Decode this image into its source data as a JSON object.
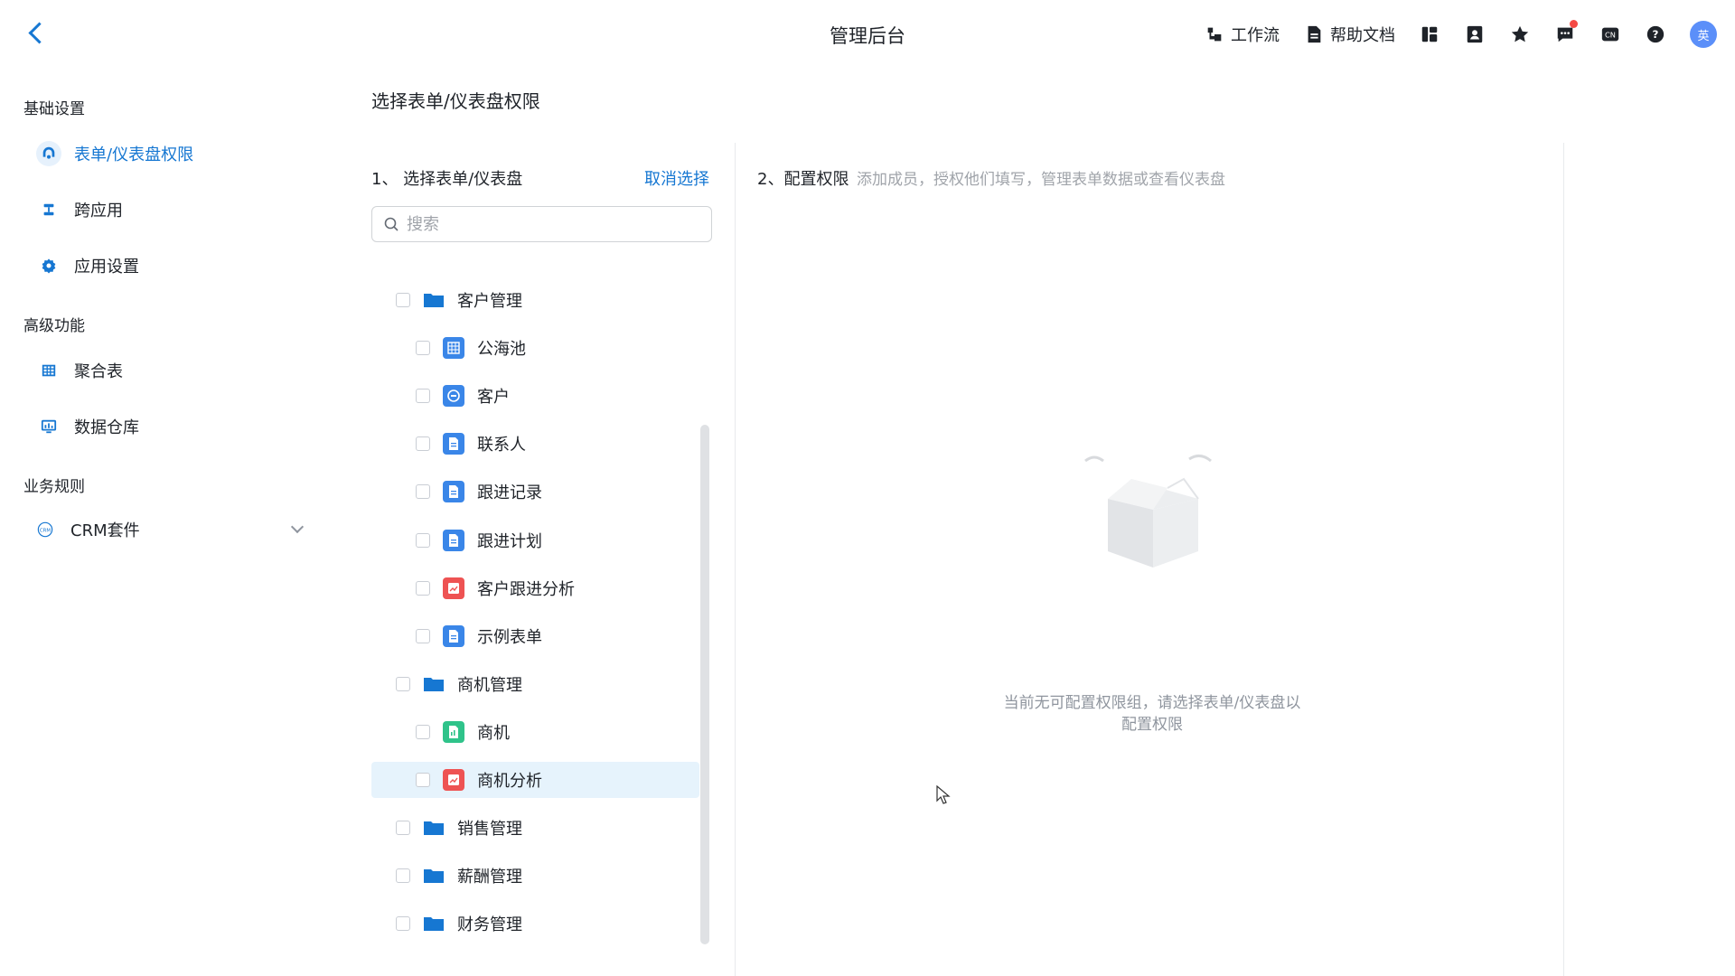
{
  "header": {
    "title": "管理后台",
    "workflow_label": "工作流",
    "help_label": "帮助文档",
    "lang_label": "CN",
    "avatar_text": "英",
    "icons": [
      "workflow-icon",
      "document-icon",
      "layout-icon",
      "contacts-icon",
      "star-icon",
      "message-icon",
      "language-icon",
      "help-icon"
    ]
  },
  "sidebar": {
    "groups": [
      {
        "label": "基础设置"
      },
      {
        "label": "高级功能"
      },
      {
        "label": "业务规则"
      }
    ],
    "items": [
      {
        "label": "表单/仪表盘权限",
        "icon": "permission-icon",
        "active": true
      },
      {
        "label": "跨应用",
        "icon": "cross-app-icon"
      },
      {
        "label": "应用设置",
        "icon": "gear-icon"
      },
      {
        "label": "聚合表",
        "icon": "table-icon"
      },
      {
        "label": "数据仓库",
        "icon": "data-warehouse-icon"
      },
      {
        "label": "CRM套件",
        "icon": "crm-icon"
      }
    ]
  },
  "main": {
    "title": "选择表单/仪表盘权限",
    "select_panel": {
      "title": "1、 选择表单/仪表盘",
      "cancel_label": "取消选择",
      "search_placeholder": "搜索"
    },
    "tree": [
      {
        "label": "客户管理",
        "level": 0,
        "type": "folder"
      },
      {
        "label": "公海池",
        "level": 1,
        "type": "table"
      },
      {
        "label": "客户",
        "level": 1,
        "type": "form"
      },
      {
        "label": "联系人",
        "level": 1,
        "type": "doc"
      },
      {
        "label": "跟进记录",
        "level": 1,
        "type": "doc"
      },
      {
        "label": "跟进计划",
        "level": 1,
        "type": "doc"
      },
      {
        "label": "客户跟进分析",
        "level": 1,
        "type": "dashboard"
      },
      {
        "label": "示例表单",
        "level": 1,
        "type": "doc"
      },
      {
        "label": "商机管理",
        "level": 0,
        "type": "folder"
      },
      {
        "label": "商机",
        "level": 1,
        "type": "green"
      },
      {
        "label": "商机分析",
        "level": 1,
        "type": "dashboard",
        "highlight": true
      },
      {
        "label": "销售管理",
        "level": 0,
        "type": "folder"
      },
      {
        "label": "薪酬管理",
        "level": 0,
        "type": "folder"
      },
      {
        "label": "财务管理",
        "level": 0,
        "type": "folder"
      }
    ],
    "config_panel": {
      "title": "2、配置权限",
      "hint": "添加成员，授权他们填写，管理表单数据或查看仪表盘",
      "empty_text": "当前无可配置权限组，请选择表单/仪表盘以配置权限"
    }
  },
  "colors": {
    "accent": "#1677d2",
    "folder": "#1677d2",
    "doc_icon_bg": "#3a86e8",
    "dashboard_icon_bg": "#ee5353",
    "green_icon_bg": "#2fc38a",
    "highlight_row": "#e6f3fc",
    "notify_dot": "#f54a45"
  }
}
